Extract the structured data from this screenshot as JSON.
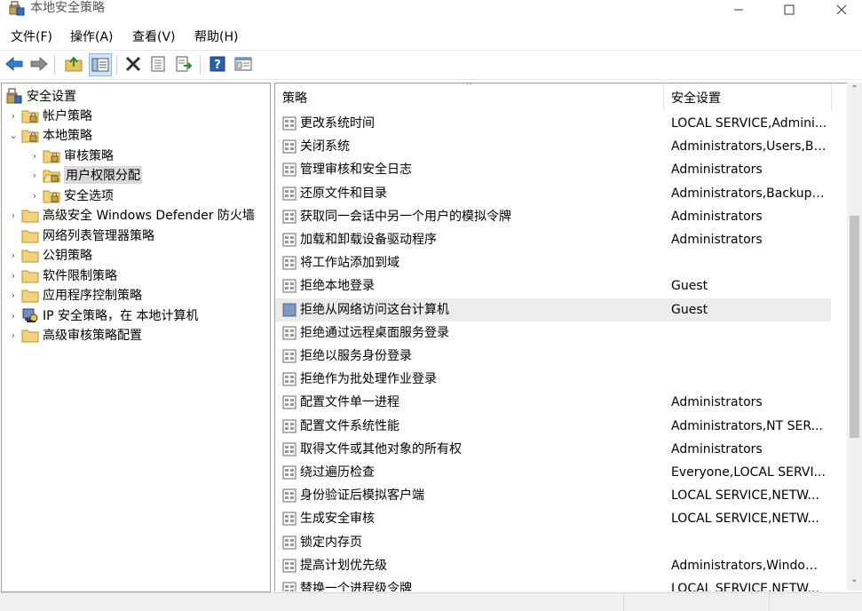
{
  "window": {
    "title": "本地安全策略",
    "controls": {
      "minimize": "—",
      "maximize": "☐",
      "close": "✕"
    }
  },
  "menu": [
    {
      "label": "文件(F)"
    },
    {
      "label": "操作(A)"
    },
    {
      "label": "查看(V)"
    },
    {
      "label": "帮助(H)"
    }
  ],
  "toolbar": {
    "buttons": [
      "back-icon",
      "forward-icon",
      "up-folder-icon",
      "show-tree-icon",
      "delete-icon",
      "properties-icon",
      "export-icon",
      "help-icon",
      "console-icon"
    ]
  },
  "tree": {
    "root": "安全设置",
    "items": [
      {
        "label": "帐户策略",
        "chevron": "›"
      },
      {
        "label": "本地策略",
        "chevron": "⌄"
      },
      {
        "label": "审核策略",
        "chevron": "›"
      },
      {
        "label": "用户权限分配",
        "chevron": "›"
      },
      {
        "label": "安全选项",
        "chevron": "›"
      },
      {
        "label": "高级安全 Windows Defender 防火墙",
        "chevron": "›"
      },
      {
        "label": "网络列表管理器策略",
        "chevron": ""
      },
      {
        "label": "公钥策略",
        "chevron": "›"
      },
      {
        "label": "软件限制策略",
        "chevron": "›"
      },
      {
        "label": "应用程序控制策略",
        "chevron": "›"
      },
      {
        "label": "IP 安全策略，在 本地计算机",
        "chevron": "›"
      },
      {
        "label": "高级审核策略配置",
        "chevron": "›"
      }
    ]
  },
  "list": {
    "columns": {
      "policy": "策略",
      "setting": "安全设置"
    },
    "sort_indicator": "^",
    "rows": [
      {
        "name": "更改系统时间",
        "value": "LOCAL SERVICE,Admini..."
      },
      {
        "name": "关闭系统",
        "value": "Administrators,Users,Ba..."
      },
      {
        "name": "管理审核和安全日志",
        "value": "Administrators"
      },
      {
        "name": "还原文件和目录",
        "value": "Administrators,Backup ..."
      },
      {
        "name": "获取同一会话中另一个用户的模拟令牌",
        "value": "Administrators"
      },
      {
        "name": "加载和卸载设备驱动程序",
        "value": "Administrators"
      },
      {
        "name": "将工作站添加到域",
        "value": ""
      },
      {
        "name": "拒绝本地登录",
        "value": "Guest"
      },
      {
        "name": "拒绝从网络访问这台计算机",
        "value": "Guest"
      },
      {
        "name": "拒绝通过远程桌面服务登录",
        "value": ""
      },
      {
        "name": "拒绝以服务身份登录",
        "value": ""
      },
      {
        "name": "拒绝作为批处理作业登录",
        "value": ""
      },
      {
        "name": "配置文件单一进程",
        "value": "Administrators"
      },
      {
        "name": "配置文件系统性能",
        "value": "Administrators,NT SER..."
      },
      {
        "name": "取得文件或其他对象的所有权",
        "value": "Administrators"
      },
      {
        "name": "绕过遍历检查",
        "value": "Everyone,LOCAL SERVI..."
      },
      {
        "name": "身份验证后模拟客户端",
        "value": "LOCAL SERVICE,NETW..."
      },
      {
        "name": "生成安全审核",
        "value": "LOCAL SERVICE,NETW..."
      },
      {
        "name": "锁定内存页",
        "value": ""
      },
      {
        "name": "提高计划优先级",
        "value": "Administrators,Window ..."
      },
      {
        "name": "替换一个进程级令牌",
        "value": "LOCAL SERVICE,NETW..."
      }
    ]
  },
  "scrollbar": {
    "up": "⌃",
    "down": "⌄"
  }
}
